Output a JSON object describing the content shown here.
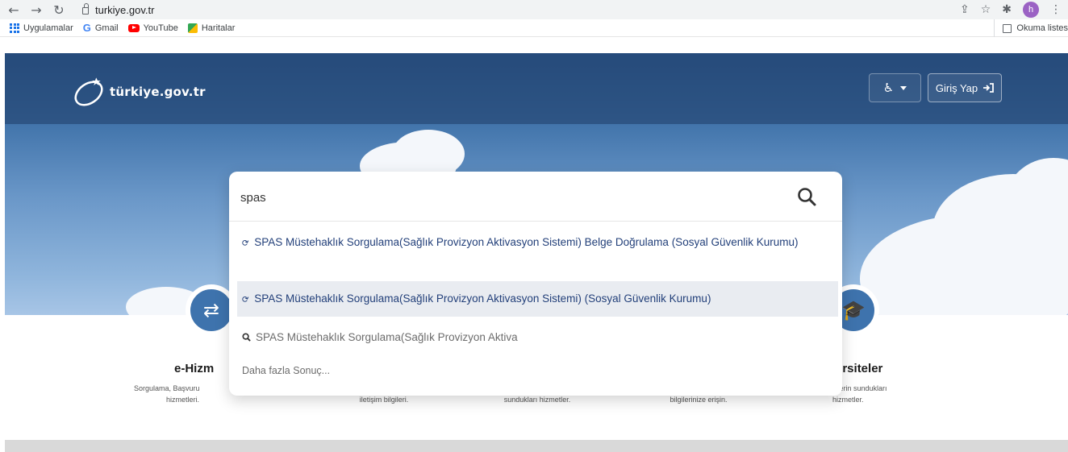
{
  "browser": {
    "url": "turkiye.gov.tr",
    "profile_initial": "h",
    "bookmarks": [
      {
        "label": "Uygulamalar",
        "icon": "apps-grid-icon"
      },
      {
        "label": "Gmail",
        "icon": "google-icon"
      },
      {
        "label": "YouTube",
        "icon": "youtube-icon"
      },
      {
        "label": "Haritalar",
        "icon": "maps-icon"
      }
    ],
    "reading_list": "Okuma listes"
  },
  "header": {
    "logo_text": "türkiye.gov.tr",
    "login_label": "Giriş Yap"
  },
  "search": {
    "query": "spas",
    "suggestions": [
      {
        "text": "SPAS Müstehaklık Sorgulama(Sağlık Provizyon Aktivasyon Sistemi) Belge Doğrulama (Sosyal Güvenlik Kurumu)",
        "icon": "refresh-icon"
      },
      {
        "text": "SPAS Müstehaklık Sorgulama(Sağlık Provizyon Aktivasyon Sistemi) (Sosyal Güvenlik Kurumu)",
        "icon": "refresh-icon"
      },
      {
        "text": "SPAS Müstehaklık Sorgulama(Sağlık Provizyon Aktiva",
        "icon": "search-icon"
      }
    ],
    "more_results": "Daha fazla Sonuç..."
  },
  "cards": [
    {
      "title": "e-Hizm",
      "desc_line1": "Sorgulama, Başvuru",
      "desc_line2": "hizmetleri."
    },
    {
      "desc": "iletişim bilgileri."
    },
    {
      "desc": "sundukları hizmetler."
    },
    {
      "desc": "bilgilerinize erişin."
    },
    {
      "title": "ersiteler",
      "desc_line1": "...elerin sundukları",
      "desc_line2": "hizmetler."
    }
  ],
  "colors": {
    "brand_blue": "#3e73ad",
    "link_blue": "#23407a"
  }
}
